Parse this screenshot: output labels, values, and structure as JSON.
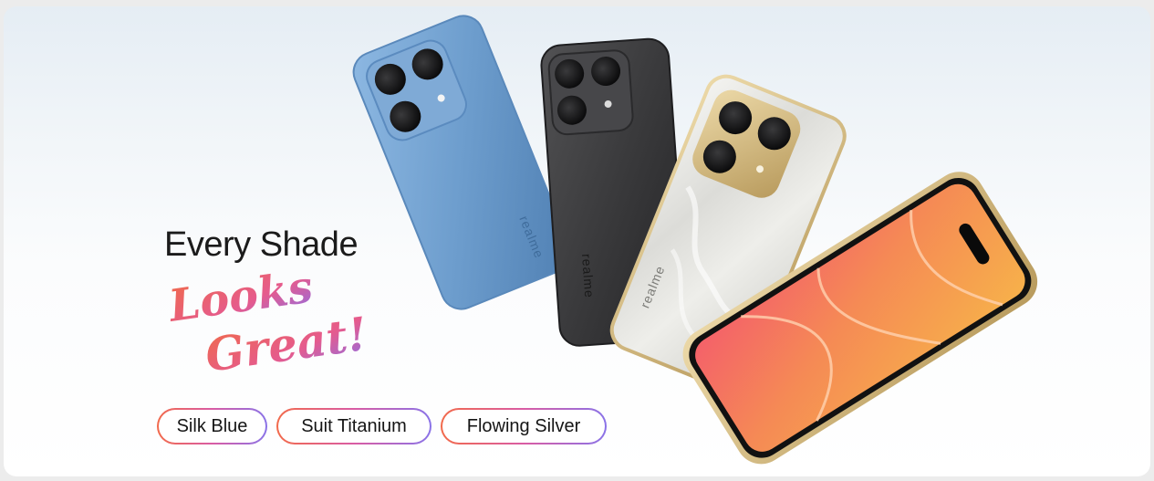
{
  "banner": {
    "headline": "Every Shade",
    "tagline_line1": "Looks",
    "tagline_line2": "Great!",
    "swatches": [
      {
        "label": "Silk Blue"
      },
      {
        "label": "Suit Titanium"
      },
      {
        "label": "Flowing Silver"
      }
    ]
  },
  "phones": {
    "brand": "realme",
    "colors": {
      "silk_blue": "#6f9fcf",
      "suit_titanium": "#3a3a3c",
      "flowing_silver": "#e3e3df",
      "gold_frame": "#d6c08a",
      "screen_warm": "#f28a4e"
    }
  },
  "accent_gradient": [
    "#f26a4b",
    "#d95ca4",
    "#8a73e8"
  ]
}
